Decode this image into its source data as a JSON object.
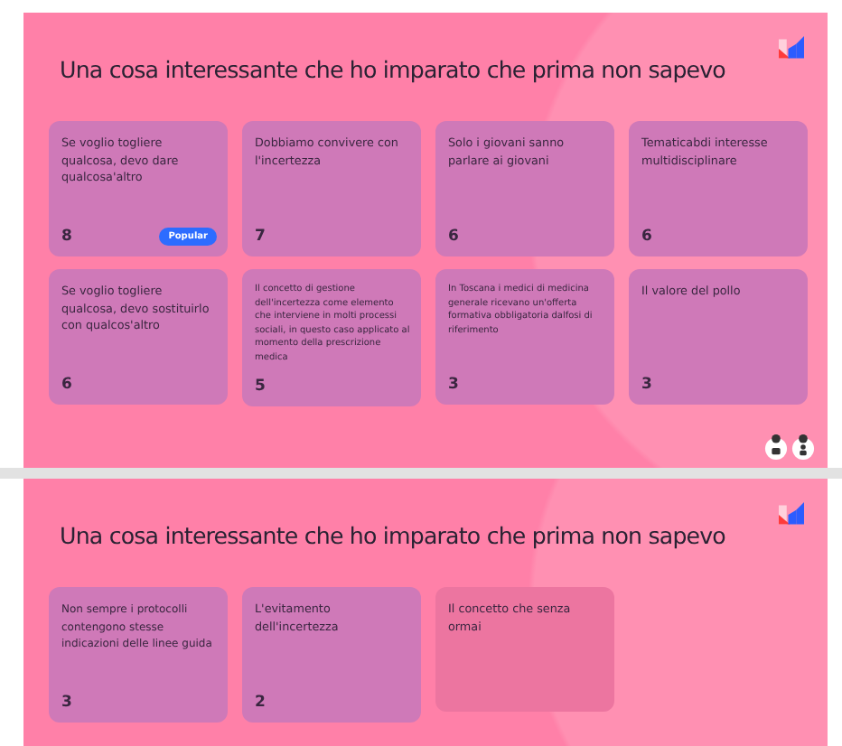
{
  "slides": [
    {
      "title": "Una cosa interessante che ho imparato che prima non sapevo",
      "show_reactions": true,
      "cards": [
        {
          "kind": "voted",
          "text": "Se voglio togliere qualcosa, devo dare qualcosa'altro",
          "count": "8",
          "badge": "Popular"
        },
        {
          "kind": "voted",
          "text": "Dobbiamo convivere con l'incertezza",
          "count": "7"
        },
        {
          "kind": "voted",
          "text": "Solo i giovani sanno parlare ai giovani",
          "count": "6"
        },
        {
          "kind": "voted",
          "text": "Tematicabdi interesse multidisciplinare",
          "count": "6"
        },
        {
          "kind": "voted",
          "text": "Se voglio togliere qualcosa, devo sostituirlo con qualcos'altro",
          "count": "6"
        },
        {
          "kind": "voted",
          "text": "Il concetto di gestione dell'incertezza come elemento che interviene in molti processi sociali, in questo caso applicato al momento della prescrizione medica",
          "count": "5"
        },
        {
          "kind": "voted",
          "text": "In Toscana i medici di medicina generale ricevano un'offerta formativa obbligatoria dalfosi di riferimento",
          "count": "3"
        },
        {
          "kind": "voted",
          "text": "Il valore del pollo",
          "count": "3"
        }
      ]
    },
    {
      "title": "Una cosa interessante che ho imparato che prima non sapevo",
      "show_reactions": false,
      "cards": [
        {
          "kind": "voted",
          "text": "Non sempre i protocolli contengono stesse indicazioni delle linee guida",
          "count": "3"
        },
        {
          "kind": "voted",
          "text": "L'evitamento dell'incertezza",
          "count": "2"
        },
        {
          "kind": "pending",
          "text": "Il concetto che senza ormai"
        }
      ]
    }
  ]
}
